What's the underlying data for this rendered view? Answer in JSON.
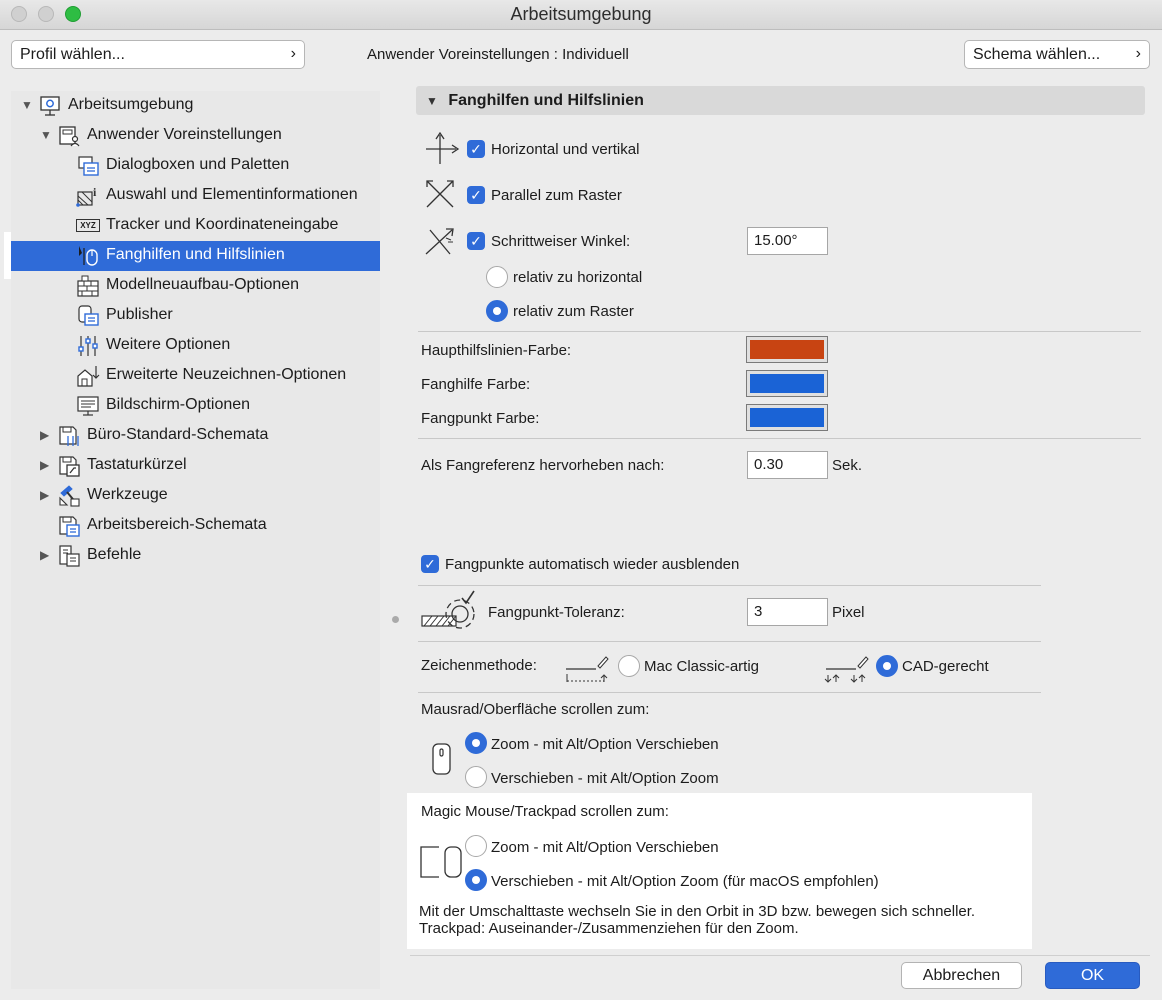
{
  "window": {
    "title": "Arbeitsumgebung"
  },
  "toolbar": {
    "profile_button": "Profil wählen...",
    "preset_label": "Anwender Voreinstellungen :",
    "preset_value": "Individuell",
    "schema_button": "Schema wählen...",
    "chevron": "›"
  },
  "tree": {
    "items": [
      {
        "label": "Arbeitsumgebung",
        "icon": "workspace-icon",
        "expander": "▼"
      },
      {
        "label": "Anwender Voreinstellungen",
        "icon": "user-preferences-icon",
        "expander": "▼"
      },
      {
        "label": "Dialogboxen und Paletten",
        "icon": "dialogs-icon"
      },
      {
        "label": "Auswahl und Elementinformationen",
        "icon": "selection-info-icon"
      },
      {
        "label": "Tracker und Koordinateneingabe",
        "icon": "tracker-icon",
        "icon_text": "XYZ"
      },
      {
        "label": "Fanghilfen und Hilfslinien",
        "icon": "snap-guides-icon",
        "selected": true
      },
      {
        "label": "Modellneuaufbau-Optionen",
        "icon": "model-rebuild-icon"
      },
      {
        "label": "Publisher",
        "icon": "publisher-icon"
      },
      {
        "label": "Weitere Optionen",
        "icon": "more-options-icon"
      },
      {
        "label": "Erweiterte Neuzeichnen-Optionen",
        "icon": "redraw-icon"
      },
      {
        "label": "Bildschirm-Optionen",
        "icon": "screen-icon"
      },
      {
        "label": "Büro-Standard-Schemata",
        "icon": "office-schemes-icon",
        "expander": "▶"
      },
      {
        "label": "Tastaturkürzel",
        "icon": "shortcuts-icon",
        "expander": "▶"
      },
      {
        "label": "Werkzeuge",
        "icon": "tools-icon",
        "expander": "▶"
      },
      {
        "label": "Arbeitsbereich-Schemata",
        "icon": "workspace-schemes-icon"
      },
      {
        "label": "Befehle",
        "icon": "commands-icon",
        "expander": "▶"
      }
    ]
  },
  "section": {
    "title": "Fanghilfen und Hilfslinien",
    "expander": "▼",
    "horizontal_vertical": "Horizontal und vertikal",
    "parallel_grid": "Parallel zum Raster",
    "stepped_angle": "Schrittweiser Winkel:",
    "stepped_angle_value": "15.00°",
    "relative_horizontal": "relativ zu horizontal",
    "relative_grid": "relativ zum Raster",
    "main_guide_color": "Haupthilfslinien-Farbe:",
    "snap_guide_color": "Fanghilfe Farbe:",
    "snap_point_color": "Fangpunkt Farbe:",
    "colors": {
      "main_guide": "#c84412",
      "snap_guide": "#1a63d6",
      "snap_point": "#1a63d6"
    },
    "highlight_after": "Als Fangreferenz hervorheben nach:",
    "highlight_after_value": "0.30",
    "highlight_after_unit": "Sek.",
    "auto_hide": "Fangpunkte automatisch wieder ausblenden",
    "tolerance": "Fangpunkt-Toleranz:",
    "tolerance_value": "3",
    "tolerance_unit": "Pixel",
    "draw_method": "Zeichenmethode:",
    "mac_classic": "Mac Classic-artig",
    "cad": "CAD-gerecht",
    "mouse_scroll": "Mausrad/Oberfläche scrollen zum:",
    "mouse_zoom": "Zoom - mit Alt/Option Verschieben",
    "mouse_pan": "Verschieben - mit Alt/Option Zoom",
    "magic_scroll": "Magic Mouse/Trackpad scrollen zum:",
    "magic_zoom": "Zoom - mit Alt/Option Verschieben",
    "magic_pan": "Verschieben - mit Alt/Option Zoom (für macOS empfohlen)",
    "note1": "Mit der Umschalttaste wechseln Sie in den Orbit in 3D bzw. bewegen sich schneller.",
    "note2": "Trackpad: Auseinander-/Zusammenziehen für den Zoom."
  },
  "footer": {
    "cancel": "Abbrechen",
    "ok": "OK"
  }
}
